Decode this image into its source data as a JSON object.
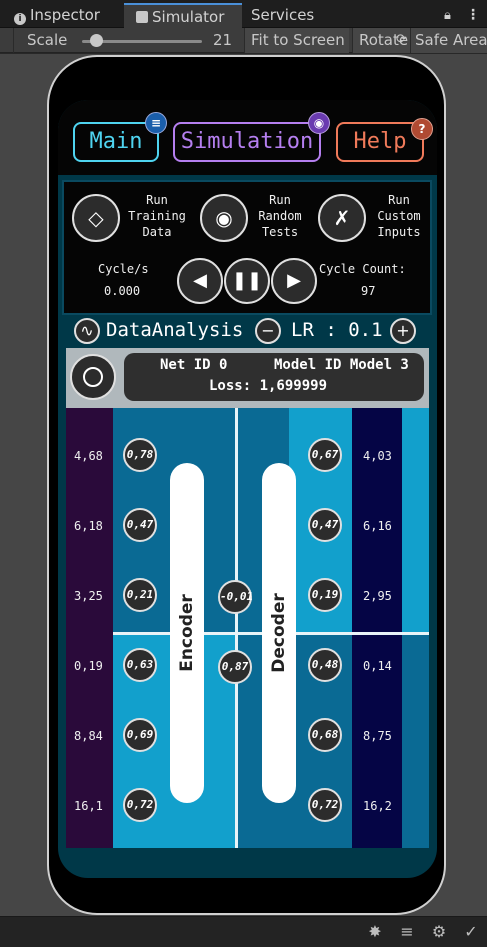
{
  "editor": {
    "tabs": [
      {
        "label": "Inspector",
        "icon": "info-icon"
      },
      {
        "label": "Simulator",
        "icon": "simulator-icon"
      },
      {
        "label": "Services",
        "icon": ""
      }
    ],
    "toolbar": {
      "scale_label": "Scale",
      "scale_value": "21",
      "fit_label": "Fit to Screen",
      "rotate_label": "Rotate",
      "safe_area_label": "Safe Area"
    }
  },
  "app": {
    "nav": {
      "main_label": "Main",
      "simulation_label": "Simulation",
      "help_label": "Help"
    },
    "actions": {
      "training_label": "Run\nTraining\nData",
      "random_label": "Run\nRandom\nTests",
      "custom_label": "Run\nCustom\nInputs"
    },
    "stats": {
      "cycle_rate_label": "Cycle/s",
      "cycle_rate_value": "0.000",
      "cycle_count_label": "Cycle Count:",
      "cycle_count_value": "97"
    },
    "lr_row": {
      "analysis_label": "DataAnalysis",
      "lr_label": "LR : 0.1"
    },
    "model": {
      "net_id": "Net ID 0",
      "model_id": "Model ID Model 3",
      "loss": "Loss: 1,699999"
    },
    "network": {
      "inputs": [
        "4,68",
        "6,18",
        "3,25",
        "0,19",
        "8,84",
        "16,1"
      ],
      "encoder_nodes": [
        "0,78",
        "0,47",
        "0,21",
        "0,63",
        "0,69",
        "0,72"
      ],
      "latent_nodes": [
        "-0,01",
        "0,87"
      ],
      "decoder_nodes": [
        "0,67",
        "0,47",
        "0,19",
        "0,48",
        "0,68",
        "0,72"
      ],
      "outputs": [
        "4,03",
        "6,16",
        "2,95",
        "0,14",
        "8,75",
        "16,2"
      ],
      "encoder_label": "Encoder",
      "decoder_label": "Decoder"
    },
    "colors": {
      "main": "#4fd4f0",
      "simulation": "#b57ff0",
      "help": "#f07a5a"
    }
  }
}
